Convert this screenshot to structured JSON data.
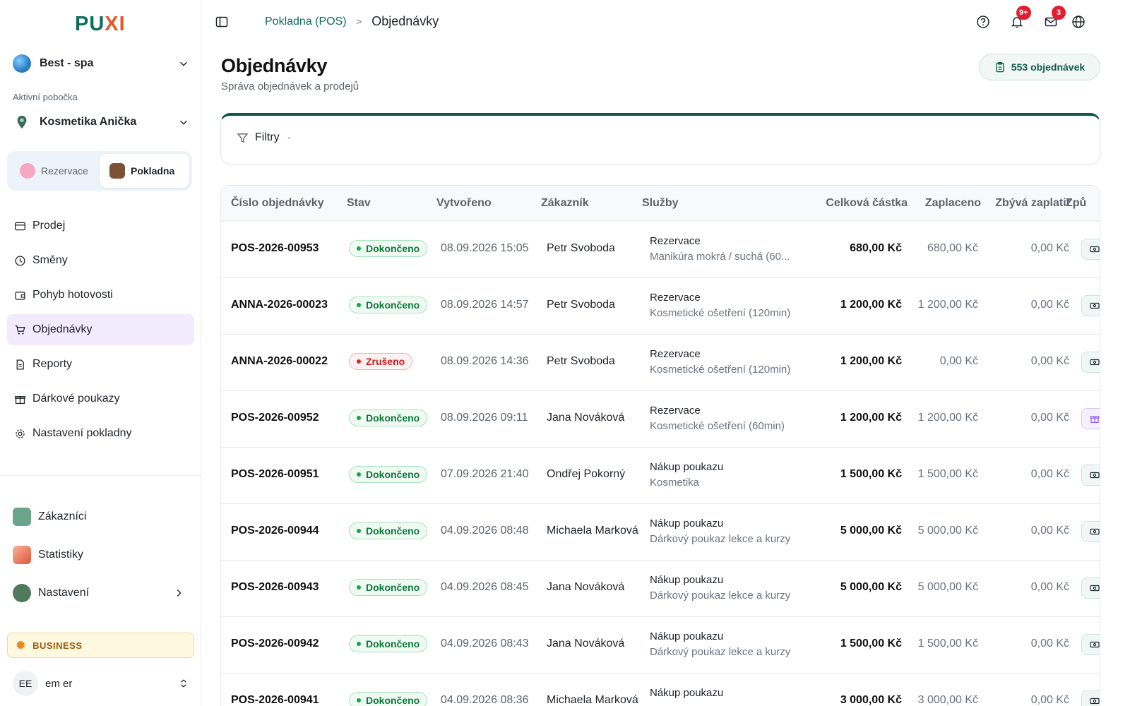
{
  "brand": {
    "logo_main": "PU",
    "logo_accent": "XI"
  },
  "sidebar": {
    "organization": "Best - spa",
    "branch_label": "Aktivní pobočka",
    "branch": "Kosmetika Anička",
    "segments": [
      {
        "label": "Rezervace",
        "active": false
      },
      {
        "label": "Pokladna",
        "active": true
      }
    ],
    "nav": [
      {
        "label": "Prodej",
        "icon": "card-icon"
      },
      {
        "label": "Směny",
        "icon": "clock-icon"
      },
      {
        "label": "Pohyb hotovosti",
        "icon": "wallet-icon"
      },
      {
        "label": "Objednávky",
        "icon": "cart-icon",
        "active": true
      },
      {
        "label": "Reporty",
        "icon": "document-icon"
      },
      {
        "label": "Dárkové poukazy",
        "icon": "gift-icon"
      },
      {
        "label": "Nastavení pokladny",
        "icon": "gear-icon"
      }
    ],
    "nav2": [
      {
        "label": "Zákazníci",
        "icon": "customers-icon"
      },
      {
        "label": "Statistiky",
        "icon": "stats-icon"
      },
      {
        "label": "Nastavení",
        "icon": "settings-icon"
      }
    ],
    "plan": "BUSINESS",
    "user": {
      "initials": "EE",
      "name": "em er"
    }
  },
  "topbar": {
    "breadcrumb_root": "Pokladna (POS)",
    "breadcrumb_current": "Objednávky",
    "notifications_badge": "9+",
    "messages_badge": "3"
  },
  "page": {
    "title": "Objednávky",
    "subtitle": "Správa objednávek a prodejů",
    "count": "553 objednávek",
    "filter_label": "Filtry"
  },
  "table": {
    "columns": [
      "Číslo objednávky",
      "Stav",
      "Vytvořeno",
      "Zákazník",
      "Služby",
      "Celková částka",
      "Zaplaceno",
      "Zbývá zaplatit",
      "Způ"
    ],
    "rows": [
      {
        "id": "POS-2026-00953",
        "status": "Dokončeno",
        "status_type": "ok",
        "created": "08.09.2026 15:05",
        "customer": "Petr Svoboda",
        "service_title": "Rezervace",
        "service_detail": "Manikúra mokrá / suchá (60...",
        "total": "680,00 Kč",
        "paid": "680,00 Kč",
        "remaining": "0,00 Kč",
        "payment": "cash"
      },
      {
        "id": "ANNA-2026-00023",
        "status": "Dokončeno",
        "status_type": "ok",
        "created": "08.09.2026 14:57",
        "customer": "Petr Svoboda",
        "service_title": "Rezervace",
        "service_detail": "Kosmetické ošetření (120min)",
        "total": "1 200,00 Kč",
        "paid": "1 200,00 Kč",
        "remaining": "0,00 Kč",
        "payment": "cash"
      },
      {
        "id": "ANNA-2026-00022",
        "status": "Zrušeno",
        "status_type": "bad",
        "created": "08.09.2026 14:36",
        "customer": "Petr Svoboda",
        "service_title": "Rezervace",
        "service_detail": "Kosmetické ošetření (120min)",
        "total": "1 200,00 Kč",
        "paid": "0,00 Kč",
        "remaining": "0,00 Kč",
        "payment": "cash"
      },
      {
        "id": "POS-2026-00952",
        "status": "Dokončeno",
        "status_type": "ok",
        "created": "08.09.2026 09:11",
        "customer": "Jana Nováková",
        "service_title": "Rezervace",
        "service_detail": "Kosmetické ošetření (60min)",
        "total": "1 200,00 Kč",
        "paid": "1 200,00 Kč",
        "remaining": "0,00 Kč",
        "payment": "gift"
      },
      {
        "id": "POS-2026-00951",
        "status": "Dokončeno",
        "status_type": "ok",
        "created": "07.09.2026 21:40",
        "customer": "Ondřej Pokorný",
        "service_title": "Nákup poukazu",
        "service_detail": "Kosmetika",
        "total": "1 500,00 Kč",
        "paid": "1 500,00 Kč",
        "remaining": "0,00 Kč",
        "payment": "cash"
      },
      {
        "id": "POS-2026-00944",
        "status": "Dokončeno",
        "status_type": "ok",
        "created": "04.09.2026 08:48",
        "customer": "Michaela Marková",
        "service_title": "Nákup poukazu",
        "service_detail": "Dárkový poukaz lekce a kurzy",
        "total": "5 000,00 Kč",
        "paid": "5 000,00 Kč",
        "remaining": "0,00 Kč",
        "payment": "cash"
      },
      {
        "id": "POS-2026-00943",
        "status": "Dokončeno",
        "status_type": "ok",
        "created": "04.09.2026 08:45",
        "customer": "Jana Nováková",
        "service_title": "Nákup poukazu",
        "service_detail": "Dárkový poukaz lekce a kurzy",
        "total": "5 000,00 Kč",
        "paid": "5 000,00 Kč",
        "remaining": "0,00 Kč",
        "payment": "cash"
      },
      {
        "id": "POS-2026-00942",
        "status": "Dokončeno",
        "status_type": "ok",
        "created": "04.09.2026 08:43",
        "customer": "Jana Nováková",
        "service_title": "Nákup poukazu",
        "service_detail": "Dárkový poukaz lekce a kurzy",
        "total": "1 500,00 Kč",
        "paid": "1 500,00 Kč",
        "remaining": "0,00 Kč",
        "payment": "cash"
      },
      {
        "id": "POS-2026-00941",
        "status": "Dokončeno",
        "status_type": "ok",
        "created": "04.09.2026 08:36",
        "customer": "Michaela Marková",
        "service_title": "Nákup poukazu",
        "service_detail": "",
        "total": "3 000,00 Kč",
        "paid": "3 000,00 Kč",
        "remaining": "0,00 Kč",
        "payment": "cash"
      }
    ]
  },
  "colors": {
    "brand": "#0f6e5a",
    "accent": "#e05a2a",
    "success": "#16a34a",
    "danger": "#dc2626",
    "nav_active": "#f1ebfd"
  }
}
